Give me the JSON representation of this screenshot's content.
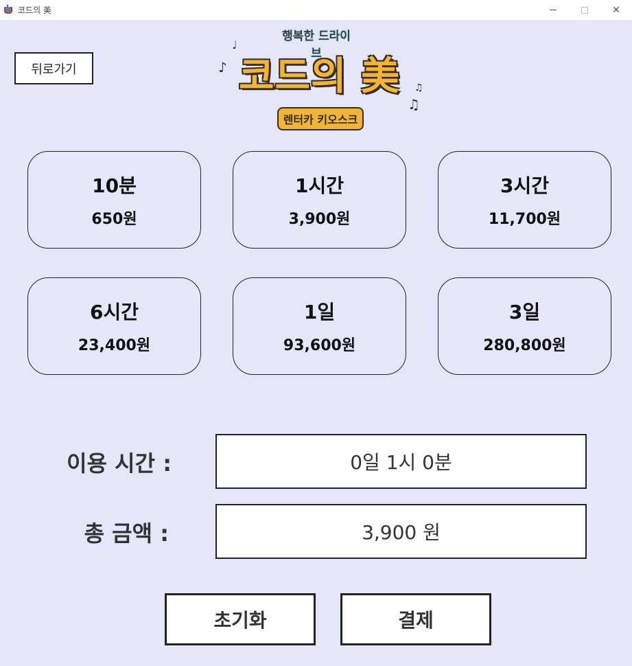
{
  "window": {
    "title": "코드의 美"
  },
  "header": {
    "back_label": "뒤로가기",
    "logo": {
      "subtitle_top": "행복한 드라이브",
      "main_title": "코드의 美",
      "pill_text": "렌터카 키오스크"
    }
  },
  "price_options": [
    {
      "duration": "10분",
      "price": "650원"
    },
    {
      "duration": "1시간",
      "price": "3,900원"
    },
    {
      "duration": "3시간",
      "price": "11,700원"
    },
    {
      "duration": "6시간",
      "price": "23,400원"
    },
    {
      "duration": "1일",
      "price": "93,600원"
    },
    {
      "duration": "3일",
      "price": "280,800원"
    }
  ],
  "summary": {
    "time_label": "이용 시간 :",
    "time_value": "0일 1시 0분",
    "total_label": "총 금액 :",
    "total_value": "3,900 원"
  },
  "actions": {
    "reset_label": "초기화",
    "pay_label": "결제"
  },
  "colors": {
    "background": "#e6e6fa",
    "logo_accent": "#f0b43c",
    "logo_outline": "#3a2e1f"
  }
}
